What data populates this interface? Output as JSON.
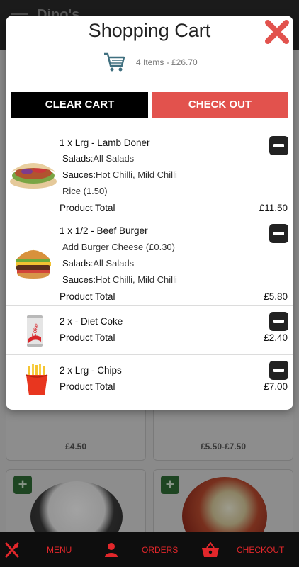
{
  "background": {
    "title": "Dino's",
    "prices": [
      "£4.50",
      "£5.50-£7.50"
    ]
  },
  "modal": {
    "title": "Shopping Cart",
    "summary": "4 Items - £26.70",
    "clear_label": "CLEAR CART",
    "checkout_label": "CHECK OUT"
  },
  "cart_items": [
    {
      "name": "1 x Lrg - Lamb Doner",
      "lines": [
        {
          "label": "Salads:",
          "value": "All Salads"
        },
        {
          "label": "Sauces:",
          "value": "Hot Chilli, Mild Chilli"
        },
        {
          "label": "",
          "value": "Rice (1.50)"
        }
      ],
      "total_label": "Product Total",
      "total": "£11.50"
    },
    {
      "name": "1 x 1/2 - Beef Burger",
      "lines": [
        {
          "label": "",
          "value": "Add Burger Cheese (£0.30)"
        },
        {
          "label": "Salads:",
          "value": "All Salads"
        },
        {
          "label": "Sauces:",
          "value": "Hot Chilli, Mild Chilli"
        }
      ],
      "total_label": "Product Total",
      "total": "£5.80"
    },
    {
      "name": "2 x - Diet Coke",
      "lines": [],
      "total_label": "Product Total",
      "total": "£2.40"
    },
    {
      "name": "2 x Lrg - Chips",
      "lines": [],
      "total_label": "Product Total",
      "total": "£7.00"
    }
  ],
  "bottom_nav": {
    "menu": "MENU",
    "orders": "ORDERS",
    "checkout": "CHECKOUT"
  },
  "colors": {
    "accent": "#e2272b",
    "checkout_button": "#e2524d",
    "clear_button": "#000000",
    "nav_background": "#0e0e0e"
  }
}
